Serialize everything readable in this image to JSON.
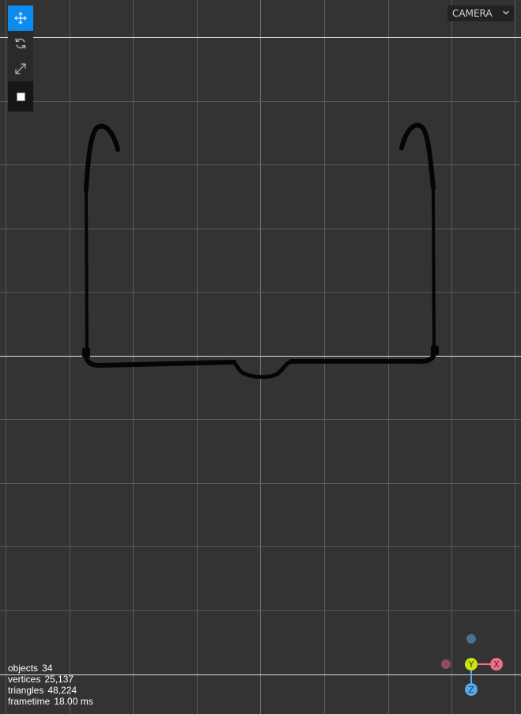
{
  "toolbar": {
    "tools": [
      {
        "icon": "move-icon",
        "active": true
      },
      {
        "icon": "rotate-icon",
        "active": false
      },
      {
        "icon": "scale-icon",
        "active": false
      }
    ],
    "mode_icon": "solid-shading-icon"
  },
  "camera": {
    "selected": "CAMERA"
  },
  "stats": {
    "objects_label": "objects",
    "objects_value": "34",
    "vertices_label": "vertices",
    "vertices_value": "25,137",
    "triangles_label": "triangles",
    "triangles_value": "48,224",
    "frametime_label": "frametime",
    "frametime_value": "18.00 ms"
  },
  "gizmo": {
    "y_label": "Y",
    "x_label": "X",
    "z_label": "Z"
  },
  "colors": {
    "viewport_bg": "#333333",
    "grid_line": "#595959",
    "horizon_line": "#dddddd",
    "active_tool": "#0d8cf0",
    "axis_x": "#f0708a",
    "axis_y": "#c7e60f",
    "axis_z": "#5aa8e8",
    "axis_neg_x": "#8c4e5e",
    "axis_neg_z": "#4a7390"
  }
}
